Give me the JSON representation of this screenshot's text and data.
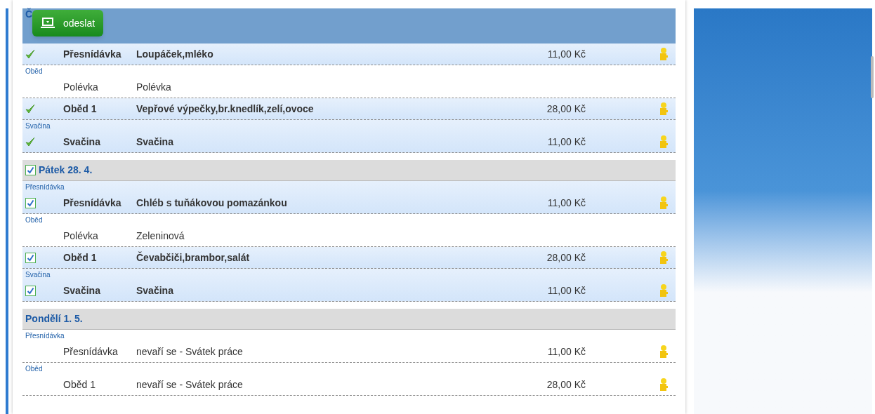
{
  "send_button": {
    "label": "odeslat"
  },
  "days": [
    {
      "title": "Č",
      "current": true,
      "meals": [
        {
          "kind": "tick",
          "ordered": true,
          "type": "Přesnídávka",
          "name": "Loupáček,mléko",
          "price": "11,00 Kč",
          "icon": true
        },
        {
          "category": "Oběd",
          "kind": "plain",
          "ordered": false,
          "type": "Polévka",
          "name": "Polévka",
          "icon": false
        },
        {
          "kind": "tick",
          "ordered": true,
          "type": "Oběd 1",
          "name": "Vepřové výpečky,br.knedlík,zelí,ovoce",
          "price": "28,00 Kč",
          "icon": true
        },
        {
          "category": "Svačina",
          "kind": "tick",
          "ordered": true,
          "type": "Svačina",
          "name": "Svačina",
          "price": "11,00 Kč",
          "icon": true
        }
      ]
    },
    {
      "title": "Pátek 28. 4.",
      "current": false,
      "checkbox": {
        "checked": true
      },
      "meals": [
        {
          "category": "Přesnídávka",
          "kind": "checkbox",
          "checked": true,
          "ordered": true,
          "type": "Přesnídávka",
          "name": "Chléb s tuňákovou pomazánkou",
          "price": "11,00 Kč",
          "icon": true
        },
        {
          "category": "Oběd",
          "kind": "plain",
          "ordered": false,
          "type": "Polévka",
          "name": "Zeleninová",
          "icon": false
        },
        {
          "kind": "checkbox",
          "checked": true,
          "ordered": true,
          "type": "Oběd 1",
          "name": "Čevabčiči,brambor,salát",
          "price": "28,00 Kč",
          "icon": true
        },
        {
          "category": "Svačina",
          "kind": "checkbox",
          "checked": true,
          "ordered": true,
          "type": "Svačina",
          "name": "Svačina",
          "price": "11,00 Kč",
          "icon": true
        }
      ]
    },
    {
      "title": "Pondělí 1. 5.",
      "current": false,
      "meals": [
        {
          "category": "Přesnídávka",
          "kind": "plain",
          "ordered": false,
          "type": "Přesnídávka",
          "name": "nevaří se - Svátek práce",
          "price": "11,00 Kč",
          "icon": true
        },
        {
          "category": "Oběd",
          "kind": "plain",
          "ordered": false,
          "type": "Oběd 1",
          "name": "nevaří se - Svátek práce",
          "price": "28,00 Kč",
          "icon": true
        }
      ]
    }
  ]
}
